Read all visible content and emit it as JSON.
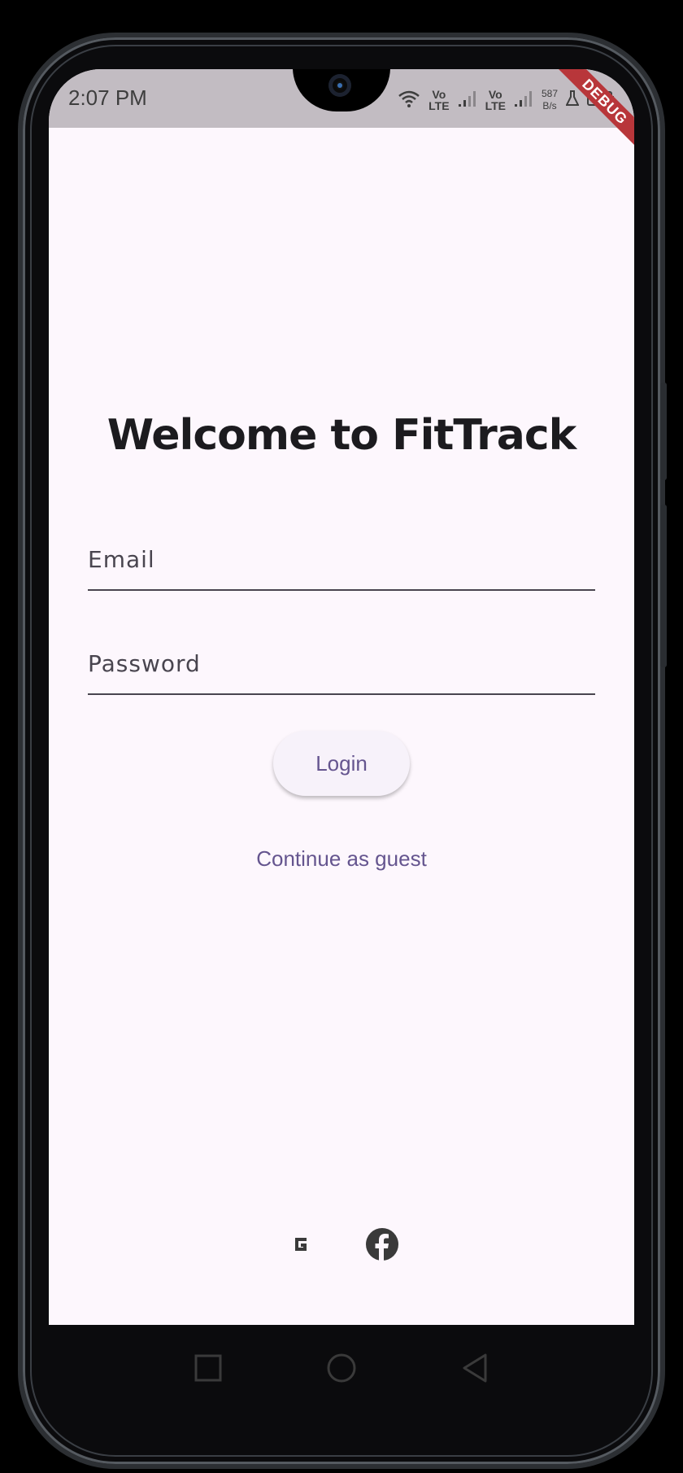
{
  "status_bar": {
    "time": "2:07 PM",
    "network_1": "Vo\nLTE",
    "network_2": "Vo\nLTE",
    "speed_value": "587",
    "speed_unit": "B/s"
  },
  "debug_banner": "DEBUG",
  "login": {
    "title": "Welcome to FitTrack",
    "email_placeholder": "Email",
    "password_placeholder": "Password",
    "login_label": "Login",
    "guest_label": "Continue as guest"
  },
  "social": [
    "google-icon",
    "facebook-icon"
  ],
  "nav": [
    "recents-square-icon",
    "home-circle-icon",
    "back-triangle-icon"
  ],
  "colors": {
    "background": "#fdf7fd",
    "accent": "#65558f",
    "status_bar": "#c2bcc2",
    "debug": "#b8363a"
  }
}
